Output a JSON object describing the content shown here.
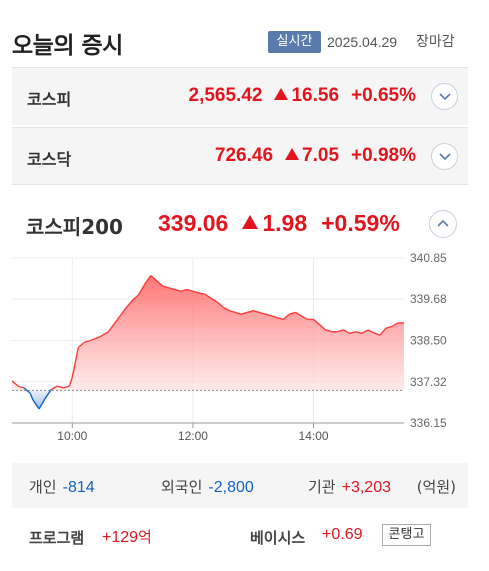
{
  "header": {
    "title": "오늘의 증시",
    "live_badge": "실시간",
    "date": "2025.04.29",
    "status": "장마감"
  },
  "indices": [
    {
      "name": "코스피",
      "value": "2,565.42",
      "change": "16.56",
      "percent": "+0.65%"
    },
    {
      "name": "코스닥",
      "value": "726.46",
      "change": "7.05",
      "percent": "+0.98%"
    }
  ],
  "kospi200": {
    "name": "코스피200",
    "value": "339.06",
    "change": "1.98",
    "percent": "+0.59%"
  },
  "colors": {
    "up": "#e2151e",
    "down": "#1360c8",
    "badge": "#5b7bad"
  },
  "icons": {
    "expand": "chevron-down-icon",
    "collapse": "chevron-up-icon",
    "rise": "up-triangle-icon"
  },
  "chart_data": {
    "type": "area",
    "xlim": [
      9,
      15.5
    ],
    "ylim": [
      336.15,
      340.85
    ],
    "yticks": [
      "340.85",
      "339.68",
      "338.50",
      "337.32",
      "336.15"
    ],
    "xticks": [
      {
        "x": 10,
        "label": "10:00"
      },
      {
        "x": 12,
        "label": "12:00"
      },
      {
        "x": 14,
        "label": "14:00"
      }
    ],
    "baseline": 337.08,
    "x": [
      9.0,
      9.1,
      9.2,
      9.3,
      9.35,
      9.45,
      9.55,
      9.65,
      9.75,
      9.85,
      9.95,
      10.0,
      10.1,
      10.2,
      10.3,
      10.45,
      10.6,
      10.75,
      10.9,
      11.0,
      11.1,
      11.2,
      11.3,
      11.4,
      11.5,
      11.6,
      11.7,
      11.8,
      11.9,
      12.0,
      12.1,
      12.2,
      12.3,
      12.4,
      12.5,
      12.6,
      12.7,
      12.8,
      12.9,
      13.0,
      13.1,
      13.2,
      13.3,
      13.4,
      13.5,
      13.6,
      13.7,
      13.8,
      13.9,
      14.0,
      14.1,
      14.2,
      14.3,
      14.4,
      14.5,
      14.6,
      14.7,
      14.8,
      14.9,
      15.0,
      15.1,
      15.2,
      15.3,
      15.4,
      15.5
    ],
    "values": [
      337.35,
      337.2,
      337.15,
      337.0,
      336.8,
      336.55,
      336.85,
      337.1,
      337.2,
      337.15,
      337.2,
      337.45,
      338.3,
      338.45,
      338.5,
      338.6,
      338.75,
      339.1,
      339.45,
      339.65,
      339.8,
      340.1,
      340.35,
      340.2,
      340.05,
      340.0,
      339.95,
      339.9,
      339.95,
      339.9,
      339.85,
      339.82,
      339.7,
      339.6,
      339.45,
      339.35,
      339.3,
      339.25,
      339.3,
      339.35,
      339.3,
      339.25,
      339.2,
      339.15,
      339.1,
      339.25,
      339.3,
      339.2,
      339.1,
      339.1,
      338.95,
      338.8,
      338.75,
      338.75,
      338.8,
      338.7,
      338.75,
      338.7,
      338.8,
      338.72,
      338.65,
      338.85,
      338.9,
      339.0,
      339.0
    ]
  },
  "investors": [
    {
      "label": "개인",
      "value": "-814",
      "dir": "down"
    },
    {
      "label": "외국인",
      "value": "-2,800",
      "dir": "down"
    },
    {
      "label": "기관",
      "value": "+3,203",
      "dir": "up"
    }
  ],
  "investors_unit": "(억원)",
  "program": {
    "label": "프로그램",
    "value": "+129",
    "unit": "억"
  },
  "basis": {
    "label": "베이시스",
    "value": "+0.69",
    "badge": "콘탱고"
  }
}
